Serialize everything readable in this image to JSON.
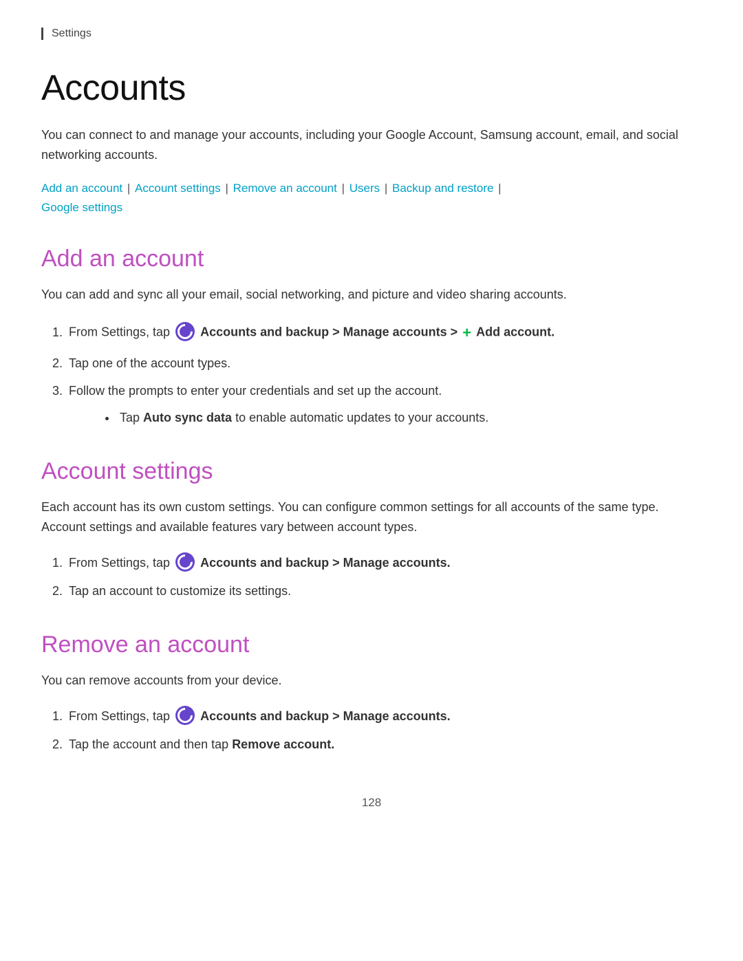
{
  "breadcrumb": "Settings",
  "page_title": "Accounts",
  "intro": "You can connect to and manage your accounts, including your Google Account, Samsung account, email, and social networking accounts.",
  "quick_links": {
    "links": [
      {
        "label": "Add an account",
        "id": "add-an-account"
      },
      {
        "label": "Account settings",
        "id": "account-settings"
      },
      {
        "label": "Remove an account",
        "id": "remove-an-account"
      },
      {
        "label": "Users",
        "id": "users"
      },
      {
        "label": "Backup and restore",
        "id": "backup-and-restore"
      },
      {
        "label": "Google settings",
        "id": "google-settings"
      }
    ]
  },
  "sections": {
    "add_account": {
      "title": "Add an account",
      "desc": "You can add and sync all your email, social networking, and picture and video sharing accounts.",
      "steps": [
        {
          "text_before": "From Settings, tap",
          "has_icon": true,
          "bold_text": "Accounts and backup > Manage accounts >",
          "add_icon": true,
          "bold_text2": "Add account."
        },
        {
          "text": "Tap one of the account types."
        },
        {
          "text": "Follow the prompts to enter your credentials and set up the account.",
          "bullet": "Tap Auto sync data to enable automatic updates to your accounts."
        }
      ]
    },
    "account_settings": {
      "title": "Account settings",
      "desc": "Each account has its own custom settings. You can configure common settings for all accounts of the same type. Account settings and available features vary between account types.",
      "steps": [
        {
          "text_before": "From Settings, tap",
          "has_icon": true,
          "bold_text": "Accounts and backup > Manage accounts."
        },
        {
          "text": "Tap an account to customize its settings."
        }
      ]
    },
    "remove_account": {
      "title": "Remove an account",
      "desc": "You can remove accounts from your device.",
      "steps": [
        {
          "text_before": "From Settings, tap",
          "has_icon": true,
          "bold_text": "Accounts and backup > Manage accounts."
        },
        {
          "text_before": "Tap the account and then tap",
          "bold_text": "Remove account."
        }
      ]
    }
  },
  "page_number": "128"
}
